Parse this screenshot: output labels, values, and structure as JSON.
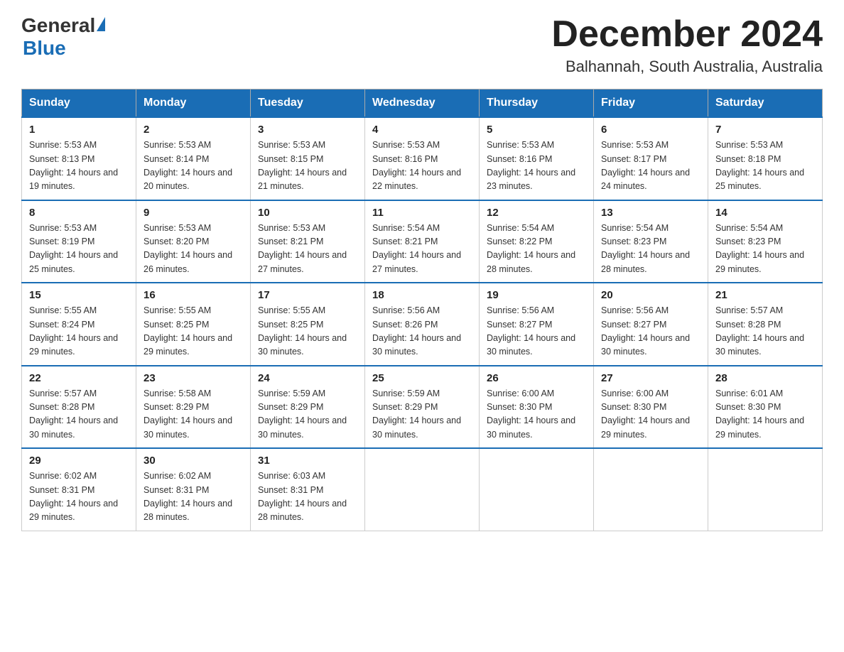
{
  "header": {
    "logo_general": "General",
    "logo_blue": "Blue",
    "month_title": "December 2024",
    "location": "Balhannah, South Australia, Australia"
  },
  "days_of_week": [
    "Sunday",
    "Monday",
    "Tuesday",
    "Wednesday",
    "Thursday",
    "Friday",
    "Saturday"
  ],
  "weeks": [
    [
      {
        "day": "1",
        "sunrise": "5:53 AM",
        "sunset": "8:13 PM",
        "daylight": "14 hours and 19 minutes."
      },
      {
        "day": "2",
        "sunrise": "5:53 AM",
        "sunset": "8:14 PM",
        "daylight": "14 hours and 20 minutes."
      },
      {
        "day": "3",
        "sunrise": "5:53 AM",
        "sunset": "8:15 PM",
        "daylight": "14 hours and 21 minutes."
      },
      {
        "day": "4",
        "sunrise": "5:53 AM",
        "sunset": "8:16 PM",
        "daylight": "14 hours and 22 minutes."
      },
      {
        "day": "5",
        "sunrise": "5:53 AM",
        "sunset": "8:16 PM",
        "daylight": "14 hours and 23 minutes."
      },
      {
        "day": "6",
        "sunrise": "5:53 AM",
        "sunset": "8:17 PM",
        "daylight": "14 hours and 24 minutes."
      },
      {
        "day": "7",
        "sunrise": "5:53 AM",
        "sunset": "8:18 PM",
        "daylight": "14 hours and 25 minutes."
      }
    ],
    [
      {
        "day": "8",
        "sunrise": "5:53 AM",
        "sunset": "8:19 PM",
        "daylight": "14 hours and 25 minutes."
      },
      {
        "day": "9",
        "sunrise": "5:53 AM",
        "sunset": "8:20 PM",
        "daylight": "14 hours and 26 minutes."
      },
      {
        "day": "10",
        "sunrise": "5:53 AM",
        "sunset": "8:21 PM",
        "daylight": "14 hours and 27 minutes."
      },
      {
        "day": "11",
        "sunrise": "5:54 AM",
        "sunset": "8:21 PM",
        "daylight": "14 hours and 27 minutes."
      },
      {
        "day": "12",
        "sunrise": "5:54 AM",
        "sunset": "8:22 PM",
        "daylight": "14 hours and 28 minutes."
      },
      {
        "day": "13",
        "sunrise": "5:54 AM",
        "sunset": "8:23 PM",
        "daylight": "14 hours and 28 minutes."
      },
      {
        "day": "14",
        "sunrise": "5:54 AM",
        "sunset": "8:23 PM",
        "daylight": "14 hours and 29 minutes."
      }
    ],
    [
      {
        "day": "15",
        "sunrise": "5:55 AM",
        "sunset": "8:24 PM",
        "daylight": "14 hours and 29 minutes."
      },
      {
        "day": "16",
        "sunrise": "5:55 AM",
        "sunset": "8:25 PM",
        "daylight": "14 hours and 29 minutes."
      },
      {
        "day": "17",
        "sunrise": "5:55 AM",
        "sunset": "8:25 PM",
        "daylight": "14 hours and 30 minutes."
      },
      {
        "day": "18",
        "sunrise": "5:56 AM",
        "sunset": "8:26 PM",
        "daylight": "14 hours and 30 minutes."
      },
      {
        "day": "19",
        "sunrise": "5:56 AM",
        "sunset": "8:27 PM",
        "daylight": "14 hours and 30 minutes."
      },
      {
        "day": "20",
        "sunrise": "5:56 AM",
        "sunset": "8:27 PM",
        "daylight": "14 hours and 30 minutes."
      },
      {
        "day": "21",
        "sunrise": "5:57 AM",
        "sunset": "8:28 PM",
        "daylight": "14 hours and 30 minutes."
      }
    ],
    [
      {
        "day": "22",
        "sunrise": "5:57 AM",
        "sunset": "8:28 PM",
        "daylight": "14 hours and 30 minutes."
      },
      {
        "day": "23",
        "sunrise": "5:58 AM",
        "sunset": "8:29 PM",
        "daylight": "14 hours and 30 minutes."
      },
      {
        "day": "24",
        "sunrise": "5:59 AM",
        "sunset": "8:29 PM",
        "daylight": "14 hours and 30 minutes."
      },
      {
        "day": "25",
        "sunrise": "5:59 AM",
        "sunset": "8:29 PM",
        "daylight": "14 hours and 30 minutes."
      },
      {
        "day": "26",
        "sunrise": "6:00 AM",
        "sunset": "8:30 PM",
        "daylight": "14 hours and 30 minutes."
      },
      {
        "day": "27",
        "sunrise": "6:00 AM",
        "sunset": "8:30 PM",
        "daylight": "14 hours and 29 minutes."
      },
      {
        "day": "28",
        "sunrise": "6:01 AM",
        "sunset": "8:30 PM",
        "daylight": "14 hours and 29 minutes."
      }
    ],
    [
      {
        "day": "29",
        "sunrise": "6:02 AM",
        "sunset": "8:31 PM",
        "daylight": "14 hours and 29 minutes."
      },
      {
        "day": "30",
        "sunrise": "6:02 AM",
        "sunset": "8:31 PM",
        "daylight": "14 hours and 28 minutes."
      },
      {
        "day": "31",
        "sunrise": "6:03 AM",
        "sunset": "8:31 PM",
        "daylight": "14 hours and 28 minutes."
      },
      null,
      null,
      null,
      null
    ]
  ]
}
